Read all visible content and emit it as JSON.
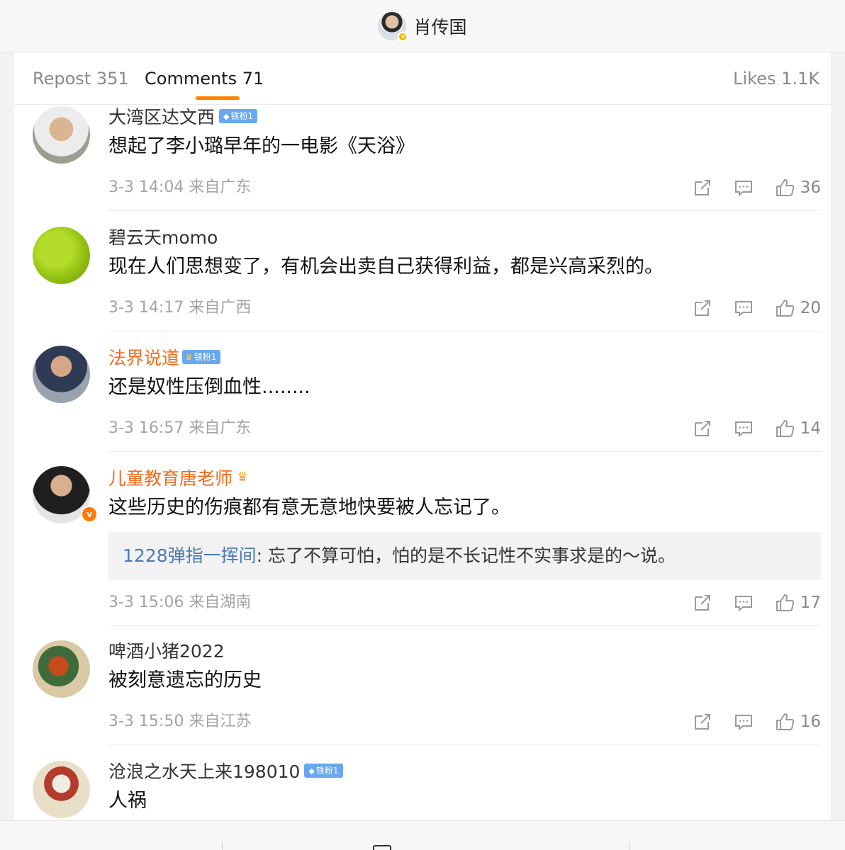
{
  "header": {
    "author_name": "肖传国"
  },
  "tabs": {
    "repost": "Repost 351",
    "comments": "Comments 71",
    "likes": "Likes 1.1K"
  },
  "comments": [
    {
      "user": "大湾区达文西",
      "badge": "铁粉1",
      "text": "想起了李小璐早年的一电影《天浴》",
      "meta": "3-3 14:04 来自广东",
      "likes": "36"
    },
    {
      "user": "碧云天momo",
      "text": "现在人们思想变了，有机会出卖自己获得利益，都是兴高采烈的。",
      "meta": "3-3 14:17 来自广西",
      "likes": "20"
    },
    {
      "user": "法界说道",
      "badge": "铁粉1",
      "text": "还是奴性压倒血性........",
      "meta": "3-3 16:57 来自广东",
      "likes": "14"
    },
    {
      "user": "儿童教育唐老师",
      "text": "这些历史的伤痕都有意无意地快要被人忘记了。",
      "reply": {
        "user": "1228弹指一挥间",
        "text": ": 忘了不算可怕，怕的是不长记性不实事求是的～说。"
      },
      "meta": "3-3 15:06 来自湖南",
      "likes": "17"
    },
    {
      "user": "啤酒小猪2022",
      "text": "被刻意遗忘的历史",
      "meta": "3-3 15:50 来自江苏",
      "likes": "16"
    },
    {
      "user": "沧浪之水天上来198010",
      "badge": "铁粉1",
      "text": "人祸"
    }
  ],
  "icons": {
    "share": "share-icon",
    "reply": "comment-icon",
    "like": "thumbs-up-icon",
    "verified": "verified-v-icon",
    "crown": "crown-icon",
    "diamond": "diamond-icon"
  },
  "colors": {
    "accent": "#ff8200",
    "vip_name": "#f26b1d",
    "link_name": "#4c7ab5",
    "fan_badge": "#69a7ee"
  }
}
